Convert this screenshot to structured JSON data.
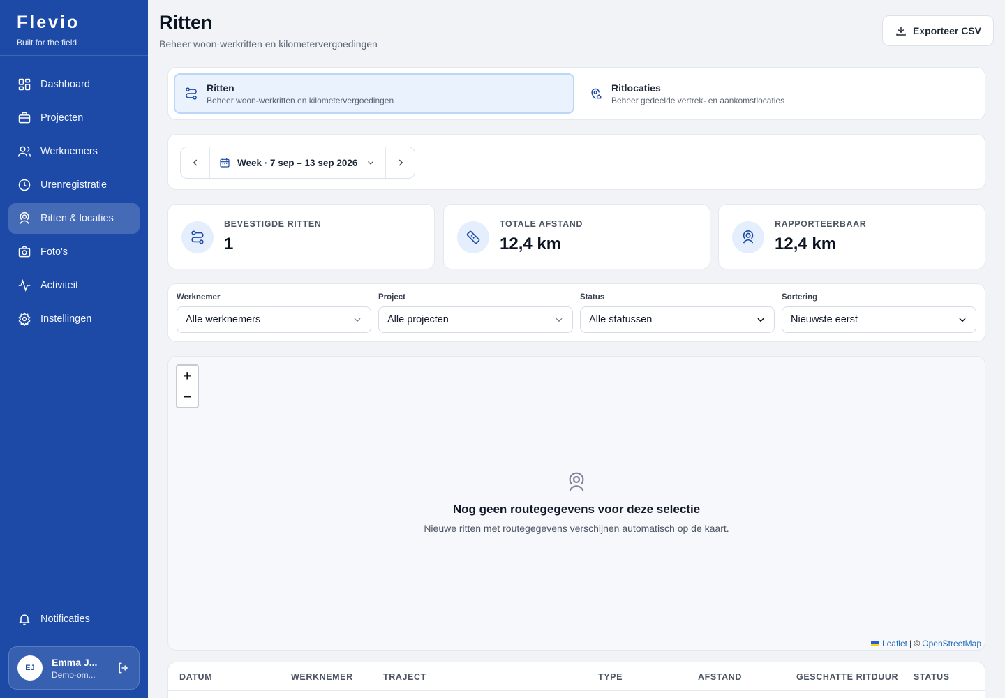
{
  "brand": {
    "name": "Flevio",
    "tagline": "Built for the field"
  },
  "sidebar": {
    "items": [
      {
        "label": "Dashboard",
        "icon": "grid-icon"
      },
      {
        "label": "Projecten",
        "icon": "briefcase-icon"
      },
      {
        "label": "Werknemers",
        "icon": "users-icon"
      },
      {
        "label": "Urenregistratie",
        "icon": "clock-icon"
      },
      {
        "label": "Ritten & locaties",
        "icon": "map-pin-user-icon",
        "active": true
      },
      {
        "label": "Foto's",
        "icon": "camera-icon"
      },
      {
        "label": "Activiteit",
        "icon": "activity-icon"
      },
      {
        "label": "Instellingen",
        "icon": "gear-icon"
      }
    ],
    "notifications_label": "Notificaties"
  },
  "user": {
    "initials": "EJ",
    "name": "Emma J...",
    "subtitle": "Demo-om..."
  },
  "header": {
    "title": "Ritten",
    "subtitle": "Beheer woon-werkritten en kilometervergoedingen",
    "export_label": "Exporteer CSV"
  },
  "tabs": [
    {
      "label": "Ritten",
      "desc": "Beheer woon-werkritten en kilometervergoedingen",
      "active": true
    },
    {
      "label": "Ritlocaties",
      "desc": "Beheer gedeelde vertrek- en aankomstlocaties",
      "active": false
    }
  ],
  "week_picker": {
    "label": "Week · 7 sep – 13 sep 2026"
  },
  "stats": [
    {
      "label": "BEVESTIGDE RITTEN",
      "value": "1",
      "icon": "route-icon"
    },
    {
      "label": "TOTALE AFSTAND",
      "value": "12,4 km",
      "icon": "ruler-icon"
    },
    {
      "label": "RAPPORTEERBAAR",
      "value": "12,4 km",
      "icon": "map-pin-user-icon"
    }
  ],
  "filters": [
    {
      "label": "Werknemer",
      "value": "Alle werknemers"
    },
    {
      "label": "Project",
      "value": "Alle projecten"
    },
    {
      "label": "Status",
      "value": "Alle statussen"
    },
    {
      "label": "Sortering",
      "value": "Nieuwste eerst"
    }
  ],
  "map": {
    "zoom_in": "+",
    "zoom_out": "−",
    "empty_title": "Nog geen routegegevens voor deze selectie",
    "empty_sub": "Nieuwe ritten met routegegevens verschijnen automatisch op de kaart.",
    "attribution_leaflet": "Leaflet",
    "attribution_sep": "| ©",
    "attribution_osm": "OpenStreetMap"
  },
  "table": {
    "columns": [
      "DATUM",
      "WERKNEMER",
      "TRAJECT",
      "TYPE",
      "AFSTAND",
      "GESCHATTE RITDUUR",
      "STATUS"
    ]
  },
  "colors": {
    "sidebar": "#1d4aa7",
    "accent": "#1d4aa7",
    "active_tab_bg": "#eaf2fe",
    "page_bg": "#f1f3f7"
  }
}
